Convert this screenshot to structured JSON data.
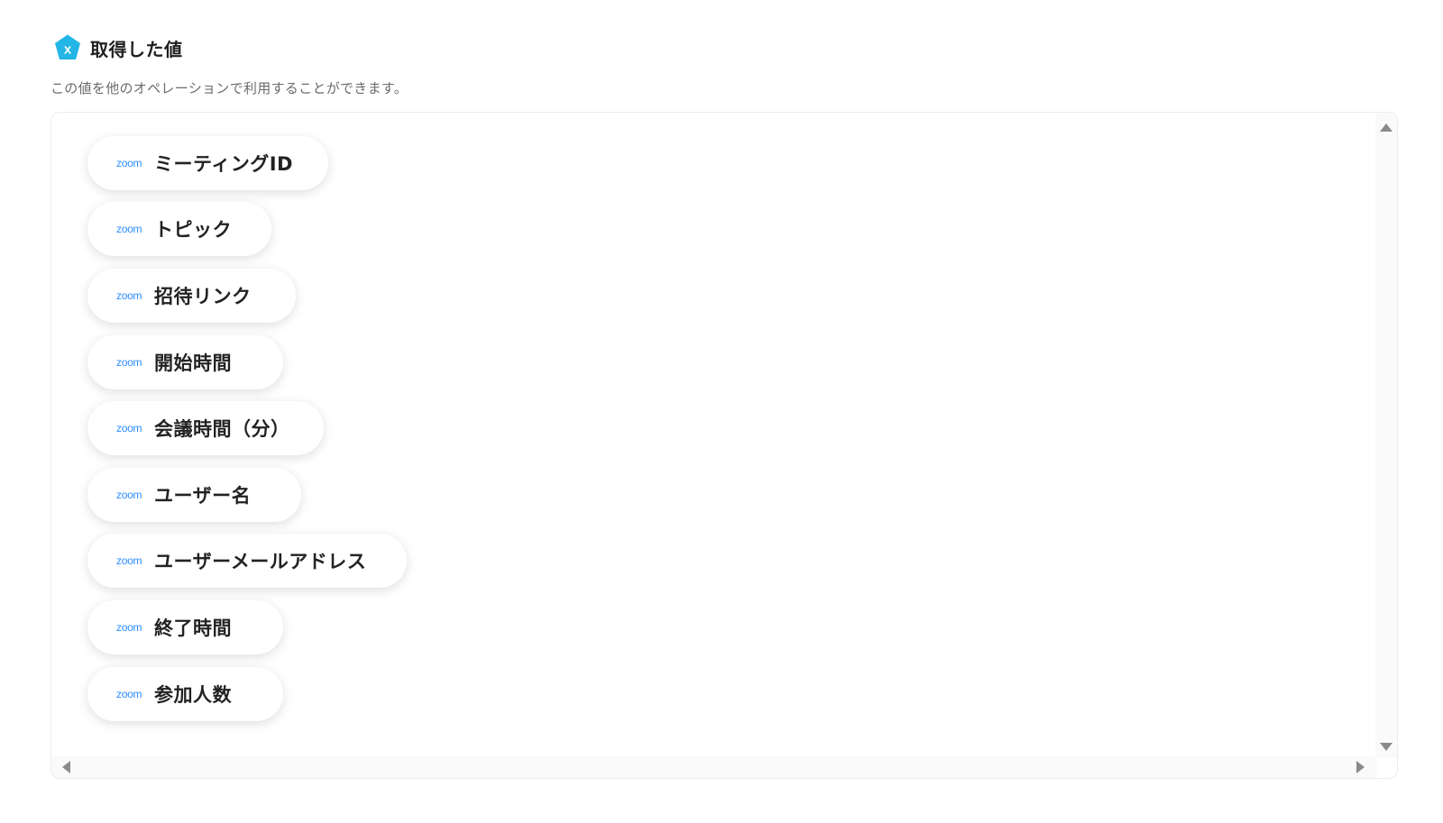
{
  "header": {
    "icon": "variable-x-icon",
    "icon_letter": "x",
    "accent_color": "#22b5e6",
    "title": "取得した値",
    "subtitle": "この値を他のオペレーションで利用することができます。"
  },
  "values": {
    "source_logo_text": "zoom",
    "source_color": "#2d8cff",
    "items": [
      {
        "label": "ミーティングID"
      },
      {
        "label": "トピック"
      },
      {
        "label": "招待リンク"
      },
      {
        "label": "開始時間"
      },
      {
        "label": "会議時間（分）"
      },
      {
        "label": "ユーザー名"
      },
      {
        "label": "ユーザーメールアドレス"
      },
      {
        "label": "終了時間"
      },
      {
        "label": "参加人数"
      }
    ]
  }
}
